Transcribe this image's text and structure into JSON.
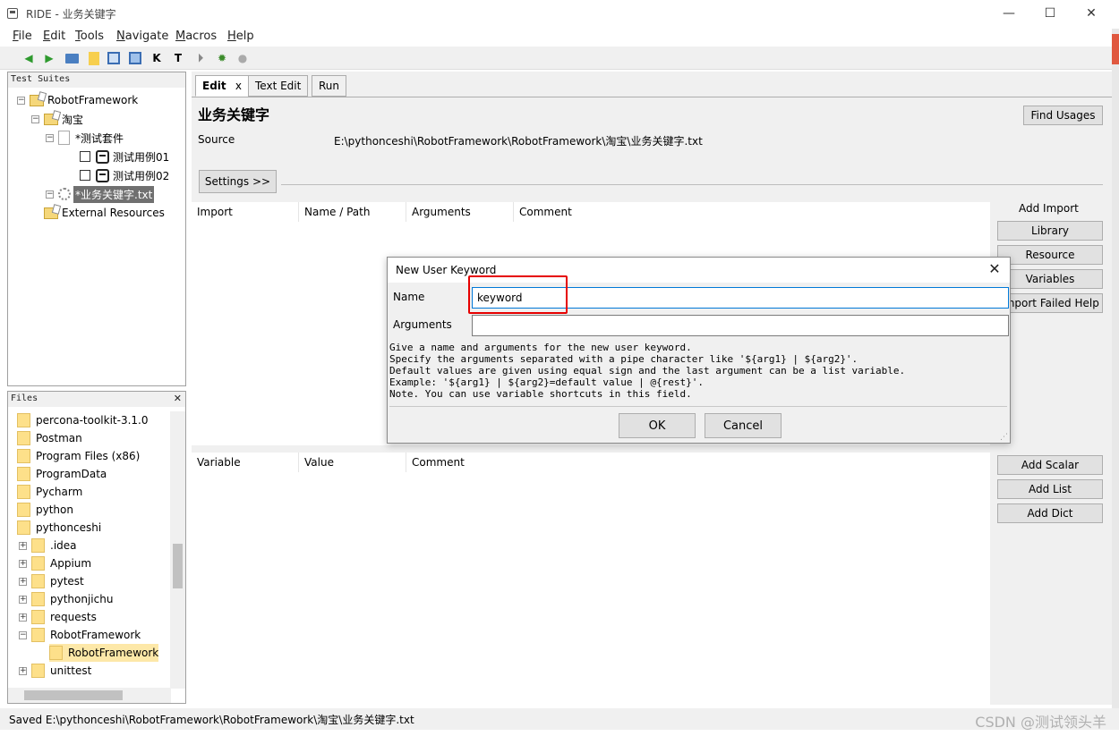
{
  "window": {
    "title": "RIDE - 业务关键字",
    "minimize": "—",
    "maximize": "☐",
    "close": "✕"
  },
  "menu": [
    "File",
    "Edit",
    "Tools",
    "Navigate",
    "Macros",
    "Help"
  ],
  "toolbar": {
    "k_label": "K",
    "t_label": "T"
  },
  "tree": {
    "header": "Test Suites",
    "nodes": [
      {
        "label": "RobotFramework",
        "icon": "folder-icon"
      },
      {
        "label": "淘宝",
        "icon": "folder-icon"
      },
      {
        "label": "*测试套件",
        "icon": "file-icon"
      },
      {
        "label": "测试用例01",
        "icon": "robot-icon"
      },
      {
        "label": "测试用例02",
        "icon": "robot-icon"
      },
      {
        "label": "*业务关键字.txt",
        "icon": "resource-icon"
      },
      {
        "label": "External Resources",
        "icon": "folder-icon"
      }
    ]
  },
  "files": {
    "header": "Files",
    "close": "✕",
    "items": [
      "percona-toolkit-3.1.0",
      "Postman",
      "Program Files (x86)",
      "ProgramData",
      "Pycharm",
      "python",
      "pythonceshi",
      ".idea",
      "Appium",
      "pytest",
      "pythonjichu",
      "requests",
      "RobotFramework",
      "RobotFramework",
      "unittest"
    ]
  },
  "tabs": [
    {
      "label": "Edit",
      "active": true
    },
    {
      "label": "Text Edit",
      "active": false
    },
    {
      "label": "Run",
      "active": false
    }
  ],
  "tab_close": "x",
  "editor": {
    "title": "业务关键字",
    "find_usages": "Find Usages",
    "source_label": "Source",
    "source_path": "E:\\pythonceshi\\RobotFramework\\RobotFramework\\淘宝\\业务关键字.txt",
    "settings_button": "Settings >>",
    "import_columns": [
      "Import",
      "Name / Path",
      "Arguments",
      "Comment"
    ],
    "add_import_label": "Add Import",
    "import_buttons": [
      "Library",
      "Resource",
      "Variables",
      "Import Failed Help"
    ],
    "variable_columns": [
      "Variable",
      "Value",
      "Comment"
    ],
    "variable_buttons": [
      "Add Scalar",
      "Add List",
      "Add Dict"
    ]
  },
  "dialog": {
    "title": "New User Keyword",
    "close": "✕",
    "name_label": "Name",
    "name_value": "keyword",
    "arguments_label": "Arguments",
    "arguments_value": "",
    "help_lines": [
      "Give a name and arguments for the new user keyword.",
      "Specify the arguments separated with a pipe character like '${arg1} | ${arg2}'.",
      "Default values are given using equal sign and the last argument can be a list variable.",
      "Example: '${arg1} | ${arg2}=default value | @{rest}'.",
      "Note. You can use variable shortcuts in this field."
    ],
    "ok": "OK",
    "cancel": "Cancel"
  },
  "status": {
    "text": "Saved E:\\pythonceshi\\RobotFramework\\RobotFramework\\淘宝\\业务关键字.txt"
  },
  "watermark": "CSDN @测试领头羊",
  "colors": {
    "highlight": "#e60000",
    "focus_border": "#0078d7",
    "selected_node": "#707070"
  }
}
